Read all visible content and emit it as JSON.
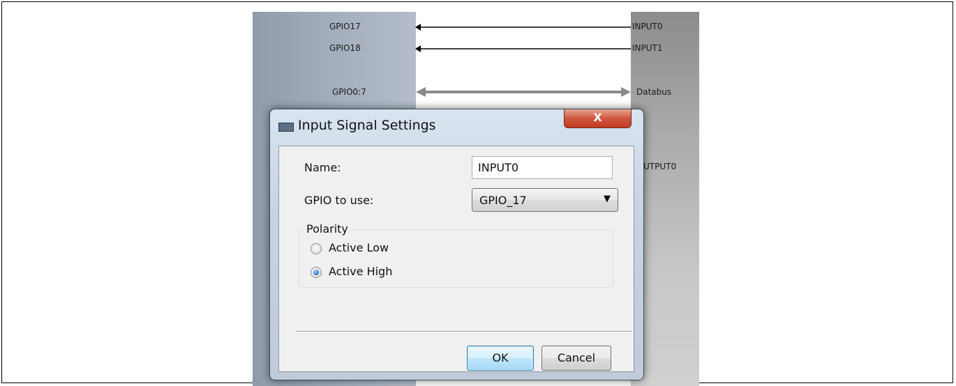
{
  "diagram": {
    "left_labels": [
      "GPIO17",
      "GPIO18",
      "GPIO0:7"
    ],
    "right_labels": [
      "INPUT0",
      "INPUT1",
      "Databus",
      "UTPUT0"
    ]
  },
  "dialog": {
    "title": "Input Signal Settings",
    "close_glyph": "X",
    "name_label": "Name:",
    "name_value": "INPUT0",
    "gpio_label": "GPIO to use:",
    "gpio_selected": "GPIO_17",
    "polarity_legend": "Polarity",
    "radio_options": [
      {
        "label": "Active Low",
        "selected": false
      },
      {
        "label": "Active High",
        "selected": true
      }
    ],
    "ok_label": "OK",
    "cancel_label": "Cancel"
  },
  "colors": {
    "close_button": "#c9452c",
    "radio_selected": "#2f7fd8",
    "default_button_border": "#3c7fb1"
  }
}
